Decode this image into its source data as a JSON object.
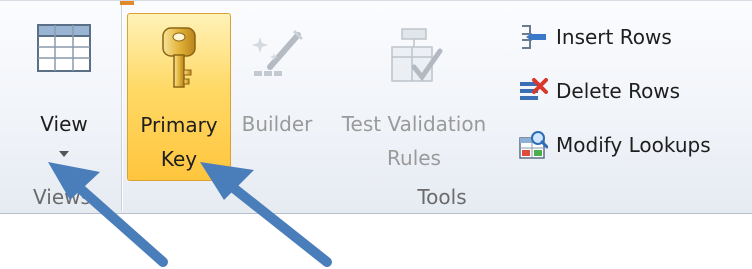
{
  "ribbon": {
    "groups": {
      "views": {
        "label": "Views"
      },
      "tools": {
        "label": "Tools"
      }
    },
    "view_button": {
      "label": "View"
    },
    "primary_key_button": {
      "label_line1": "Primary",
      "label_line2": "Key"
    },
    "builder_button": {
      "label": "Builder"
    },
    "test_validation_button": {
      "label_line1": "Test Validation",
      "label_line2": "Rules"
    },
    "insert_rows": {
      "label": "Insert Rows"
    },
    "delete_rows": {
      "label": "Delete Rows"
    },
    "modify_lookups": {
      "label": "Modify Lookups"
    }
  },
  "colors": {
    "highlight": "#ffd966",
    "annotation_arrow": "#4a7ebb"
  },
  "icons": [
    "table-grid-icon",
    "chevron-down-icon",
    "key-icon",
    "builder-wand-icon",
    "test-validation-icon",
    "insert-rows-icon",
    "delete-rows-icon",
    "modify-lookups-icon",
    "arrow-annotation-icon"
  ]
}
